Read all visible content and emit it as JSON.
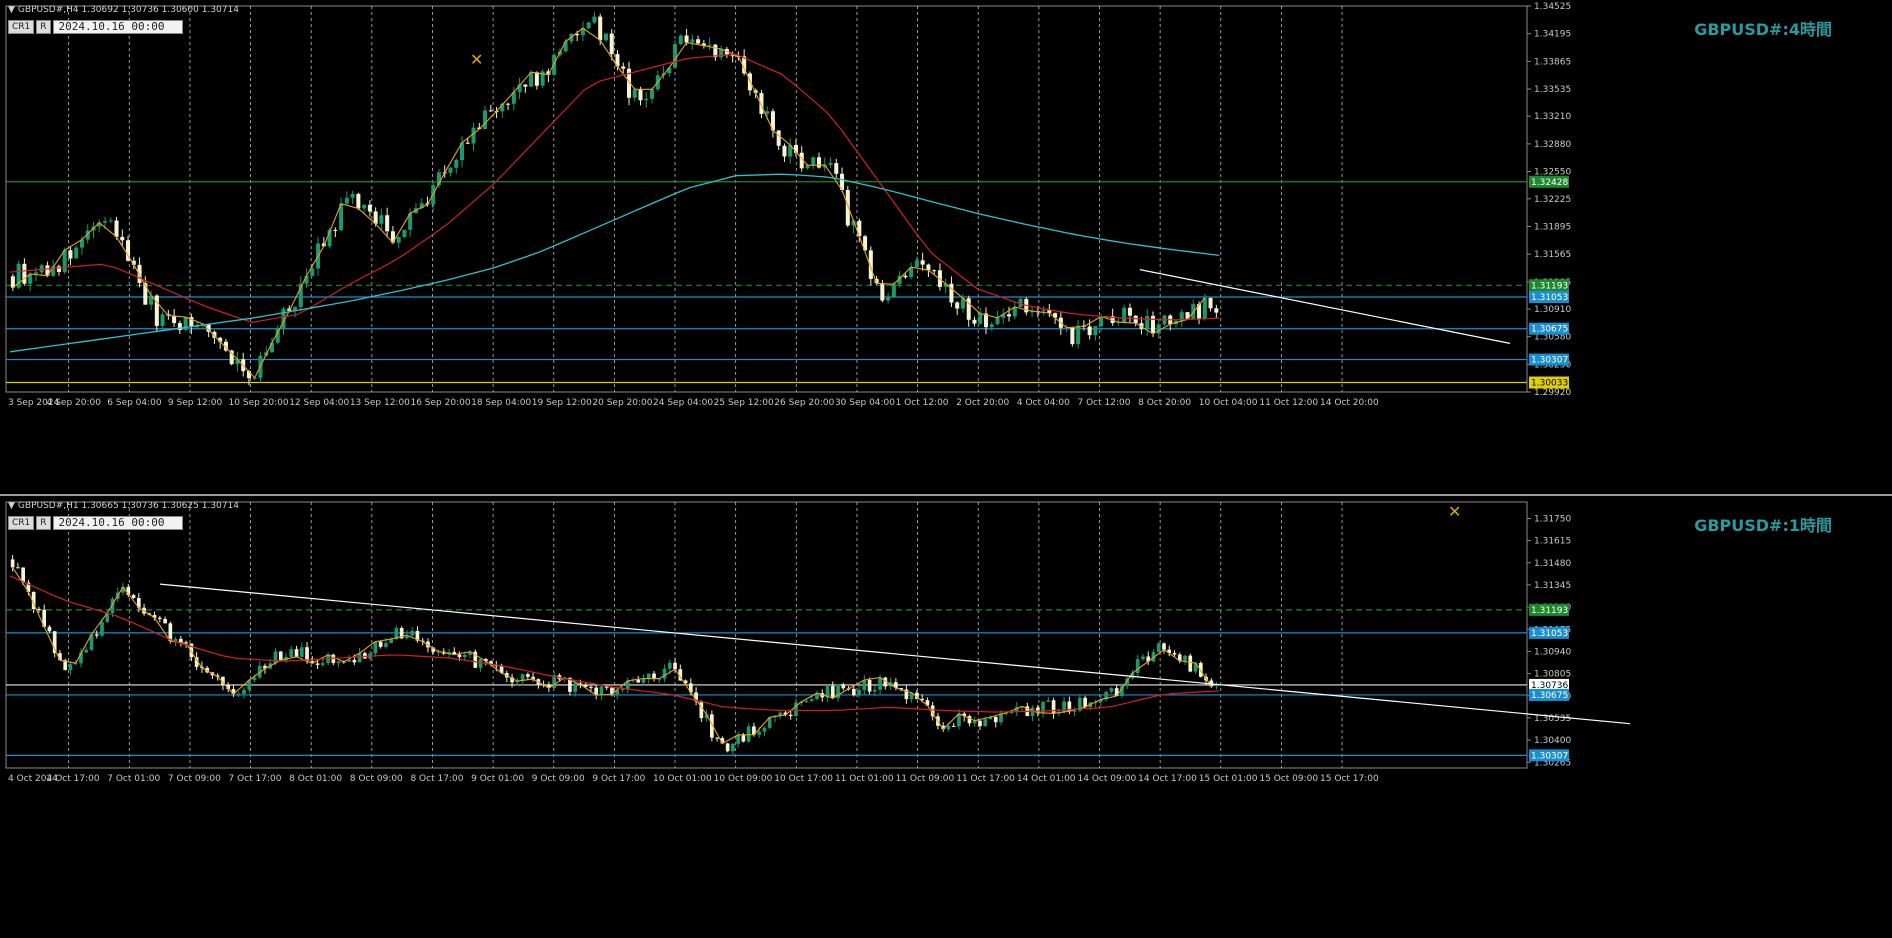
{
  "colors": {
    "background": "#000000",
    "bull_candle": "#1a9a6e",
    "bear_candle": "#f5f5d0",
    "zigzag": "#e8a21c",
    "ma_fast": "#d02020",
    "ma_slow": "#30c0d0",
    "trendline": "#ffffff",
    "support_line": "#1a8fd0",
    "green_level": "#1c8a2c",
    "yellow_level": "#e0d000",
    "title": "#2a9aa0"
  },
  "pane_h4": {
    "symbol_info": "GBPUSD#,H4  1.30692 1.30736 1.30600 1.30714",
    "buttons": [
      "CR1",
      "R"
    ],
    "datetime": "2024.10.16 00:00",
    "title": "GBPUSD#:4時間",
    "trade_icon": "trade-arrows-icon",
    "y_ticks": [
      "1.34525",
      "1.34195",
      "1.33865",
      "1.33535",
      "1.33210",
      "1.32880",
      "1.32550",
      "1.32225",
      "1.31895",
      "1.31565",
      "1.31235",
      "1.30910",
      "1.30580",
      "1.30250",
      "1.29920"
    ],
    "x_labels": [
      "3 Sep 2024",
      "4 Sep 20:00",
      "6 Sep 04:00",
      "9 Sep 12:00",
      "10 Sep 20:00",
      "12 Sep 04:00",
      "13 Sep 12:00",
      "16 Sep 20:00",
      "18 Sep 04:00",
      "19 Sep 12:00",
      "20 Sep 20:00",
      "24 Sep 04:00",
      "25 Sep 12:00",
      "26 Sep 20:00",
      "30 Sep 04:00",
      "1 Oct 12:00",
      "2 Oct 20:00",
      "4 Oct 04:00",
      "7 Oct 12:00",
      "8 Oct 20:00",
      "10 Oct 04:00",
      "11 Oct 12:00",
      "14 Oct 20:00"
    ],
    "levels": [
      {
        "name": "green-level-upper",
        "value": 1.32428,
        "label": "1.32428",
        "kind": "green"
      },
      {
        "name": "green-dashed-level",
        "value": 1.31193,
        "label": "1.31193",
        "kind": "green-dashed"
      },
      {
        "name": "resistance-level",
        "value": 1.31053,
        "label": "1.31053",
        "kind": "blue"
      },
      {
        "name": "mid-level",
        "value": 1.30675,
        "label": "1.30675",
        "kind": "blue"
      },
      {
        "name": "support-level",
        "value": 1.30307,
        "label": "1.30307",
        "kind": "blue"
      },
      {
        "name": "bottom-level",
        "value": 1.30033,
        "label": "1.30033",
        "kind": "yellow"
      }
    ]
  },
  "pane_h1": {
    "symbol_info": "GBPUSD#,H1  1.30665 1.30736 1.30625 1.30714",
    "buttons": [
      "CR1",
      "R"
    ],
    "datetime": "2024.10.16 00:00",
    "title": "GBPUSD#:1時間",
    "trade_icon": "trade-arrows-icon",
    "y_ticks": [
      "1.31750",
      "1.31615",
      "1.31480",
      "1.31345",
      "1.31210",
      "1.31075",
      "1.30940",
      "1.30805",
      "1.30670",
      "1.30535",
      "1.30400",
      "1.30265"
    ],
    "x_labels": [
      "4 Oct 2024",
      "4 Oct 17:00",
      "7 Oct 01:00",
      "7 Oct 09:00",
      "7 Oct 17:00",
      "8 Oct 01:00",
      "8 Oct 09:00",
      "8 Oct 17:00",
      "9 Oct 01:00",
      "9 Oct 09:00",
      "9 Oct 17:00",
      "10 Oct 01:00",
      "10 Oct 09:00",
      "10 Oct 17:00",
      "11 Oct 01:00",
      "11 Oct 09:00",
      "11 Oct 17:00",
      "14 Oct 01:00",
      "14 Oct 09:00",
      "14 Oct 17:00",
      "15 Oct 01:00",
      "15 Oct 09:00",
      "15 Oct 17:00"
    ],
    "levels": [
      {
        "name": "green-dashed-level",
        "value": 1.31193,
        "label": "1.31193",
        "kind": "green-dashed"
      },
      {
        "name": "resistance-level",
        "value": 1.31053,
        "label": "1.31053",
        "kind": "blue"
      },
      {
        "name": "price-level",
        "value": 1.30736,
        "label": "1.30736",
        "kind": "white"
      },
      {
        "name": "mid-level",
        "value": 1.30675,
        "label": "1.30675",
        "kind": "blue"
      },
      {
        "name": "support-level",
        "value": 1.30307,
        "label": "1.30307",
        "kind": "blue"
      }
    ]
  },
  "chart_data": [
    {
      "type": "candlestick",
      "symbol": "GBPUSD#",
      "timeframe": "H4",
      "ylim": [
        1.2992,
        1.34525
      ],
      "x": [
        "3 Sep 2024",
        "4 Sep 20:00",
        "6 Sep 04:00",
        "9 Sep 12:00",
        "10 Sep 20:00",
        "12 Sep 04:00",
        "13 Sep 12:00",
        "16 Sep 20:00",
        "18 Sep 04:00",
        "19 Sep 12:00",
        "20 Sep 20:00",
        "24 Sep 04:00",
        "25 Sep 12:00",
        "26 Sep 20:00",
        "30 Sep 04:00",
        "1 Oct 12:00",
        "2 Oct 20:00",
        "4 Oct 04:00",
        "7 Oct 12:00",
        "8 Oct 20:00",
        "10 Oct 04:00",
        "11 Oct 12:00",
        "14 Oct 20:00"
      ],
      "close_path": [
        1.313,
        1.3145,
        1.32,
        1.308,
        1.307,
        1.301,
        1.312,
        1.3225,
        1.3175,
        1.326,
        1.333,
        1.337,
        1.3445,
        1.333,
        1.342,
        1.3395,
        1.328,
        1.3255,
        1.3105,
        1.3145,
        1.3075,
        1.3095,
        1.306,
        1.308,
        1.307,
        1.31
      ],
      "series": [
        {
          "name": "close",
          "values": [
            1.313,
            1.3145,
            1.32,
            1.308,
            1.307,
            1.301,
            1.312,
            1.3225,
            1.3175,
            1.326,
            1.333,
            1.337,
            1.3445,
            1.333,
            1.342,
            1.3395,
            1.328,
            1.3255,
            1.3105,
            1.3145,
            1.3075,
            1.3095,
            1.306,
            1.308,
            1.307,
            1.31
          ]
        }
      ],
      "ma_fast": [
        1.3135,
        1.314,
        1.3145,
        1.312,
        1.3095,
        1.3075,
        1.3085,
        1.312,
        1.315,
        1.319,
        1.324,
        1.33,
        1.336,
        1.3375,
        1.339,
        1.3395,
        1.337,
        1.332,
        1.324,
        1.316,
        1.3115,
        1.3095,
        1.3085,
        1.308,
        1.3078,
        1.308
      ],
      "ma_slow": [
        1.304,
        1.3048,
        1.3056,
        1.3064,
        1.3072,
        1.308,
        1.309,
        1.31,
        1.3112,
        1.3125,
        1.314,
        1.316,
        1.3185,
        1.321,
        1.3235,
        1.325,
        1.3252,
        1.3248,
        1.3235,
        1.322,
        1.3205,
        1.3192,
        1.318,
        1.317,
        1.3162,
        1.3155
      ],
      "levels": [
        1.32428,
        1.31193,
        1.31053,
        1.30675,
        1.30307,
        1.30033
      ]
    },
    {
      "type": "candlestick",
      "symbol": "GBPUSD#",
      "timeframe": "H1",
      "ylim": [
        1.3023,
        1.3185
      ],
      "x": [
        "4 Oct 2024",
        "4 Oct 17:00",
        "7 Oct 01:00",
        "7 Oct 09:00",
        "7 Oct 17:00",
        "8 Oct 01:00",
        "8 Oct 09:00",
        "8 Oct 17:00",
        "9 Oct 01:00",
        "9 Oct 09:00",
        "9 Oct 17:00",
        "10 Oct 01:00",
        "10 Oct 09:00",
        "10 Oct 17:00",
        "11 Oct 01:00",
        "11 Oct 09:00",
        "11 Oct 17:00",
        "14 Oct 01:00",
        "14 Oct 09:00",
        "14 Oct 17:00",
        "15 Oct 01:00",
        "15 Oct 09:00",
        "15 Oct 17:00"
      ],
      "series": [
        {
          "name": "close",
          "values": [
            1.315,
            1.308,
            1.313,
            1.31,
            1.3065,
            1.3095,
            1.3085,
            1.3105,
            1.3095,
            1.308,
            1.3075,
            1.307,
            1.3085,
            1.3035,
            1.3055,
            1.307,
            1.3075,
            1.305,
            1.3055,
            1.306,
            1.3065,
            1.31,
            1.3071
          ]
        }
      ],
      "ma_fast": [
        1.314,
        1.3125,
        1.3115,
        1.31,
        1.309,
        1.3088,
        1.309,
        1.3092,
        1.309,
        1.3085,
        1.3078,
        1.3072,
        1.3068,
        1.306,
        1.3058,
        1.3058,
        1.306,
        1.3058,
        1.3057,
        1.3058,
        1.306,
        1.3068,
        1.307
      ],
      "levels": [
        1.31193,
        1.31053,
        1.30736,
        1.30675,
        1.30307
      ]
    }
  ]
}
